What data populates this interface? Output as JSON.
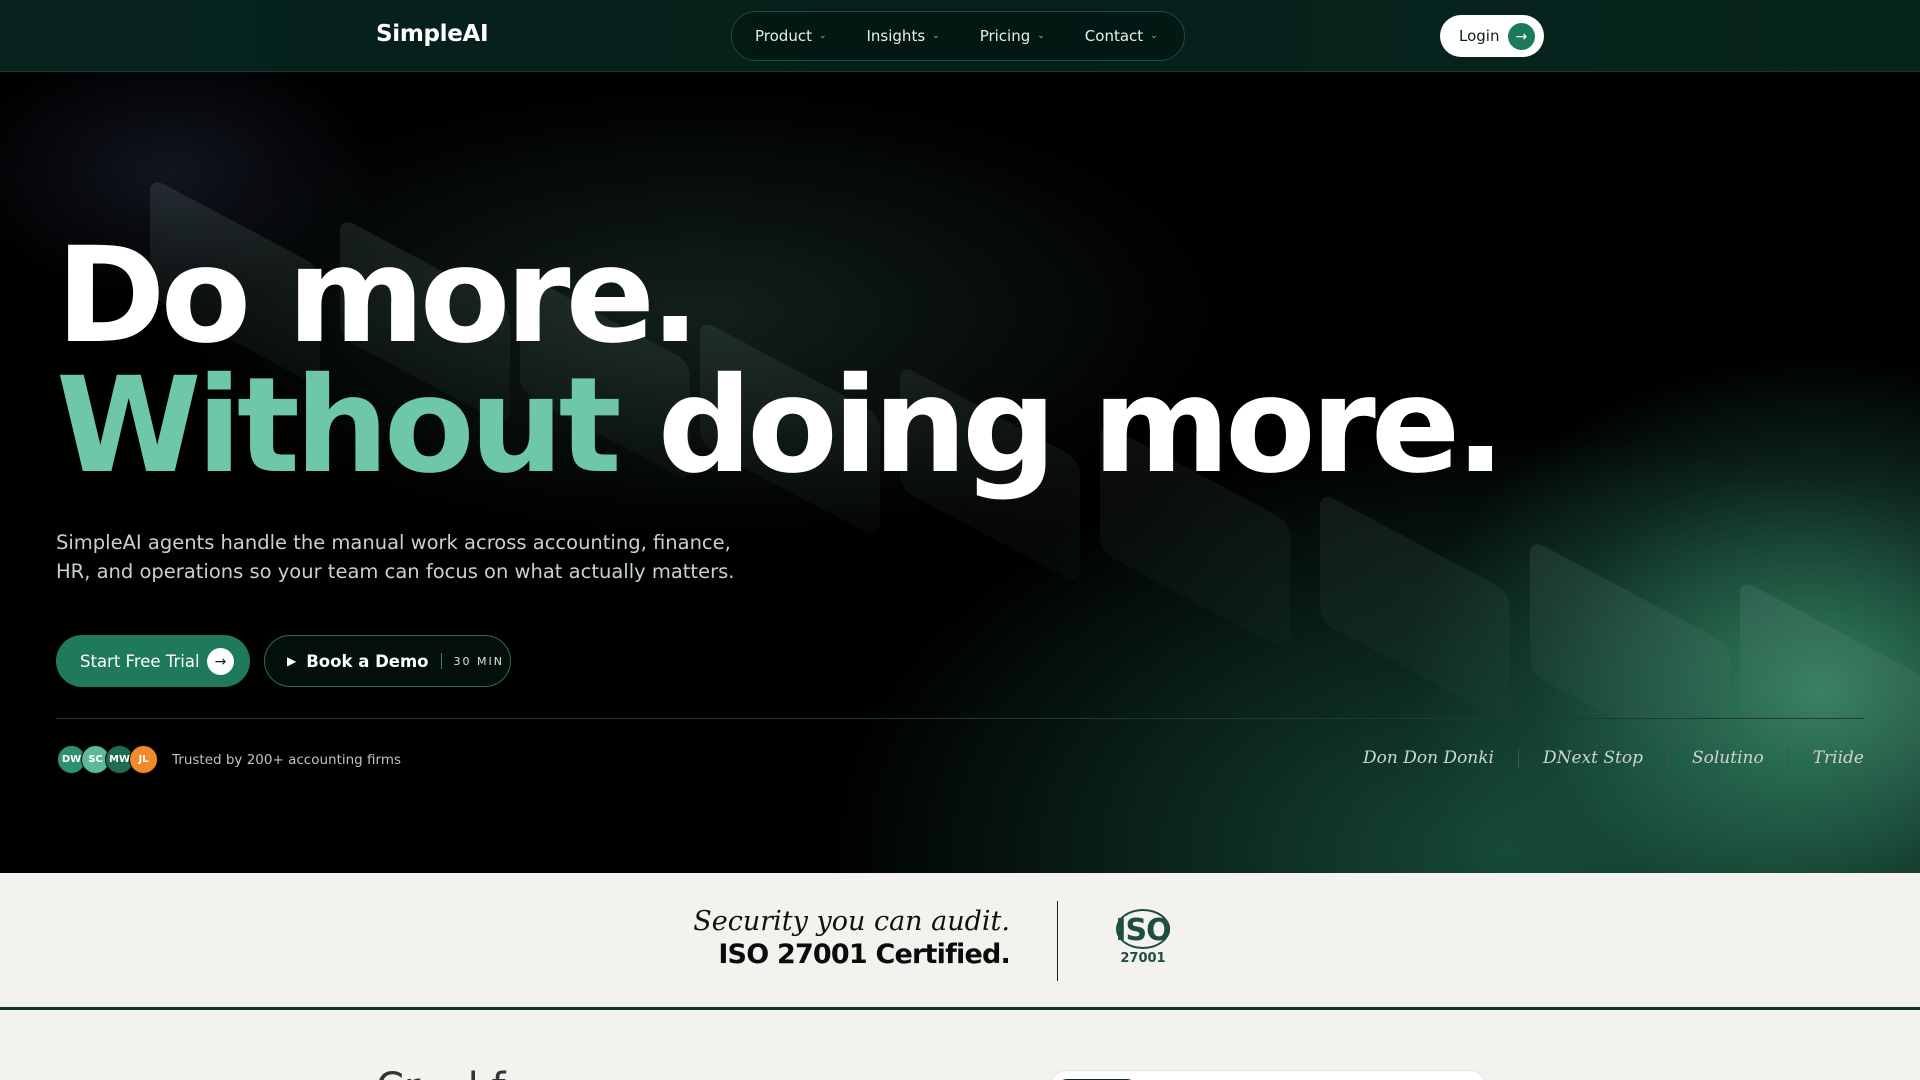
{
  "nav": {
    "brand": "SimpleAI",
    "menu": [
      {
        "label": "Product"
      },
      {
        "label": "Insights"
      },
      {
        "label": "Pricing"
      },
      {
        "label": "Contact"
      }
    ],
    "login_label": "Login"
  },
  "hero": {
    "line1": "Do more.",
    "line2_accent": "Without",
    "line2_rest": "doing more.",
    "subtitle": "SimpleAI agents handle the manual work across accounting, finance, HR, and operations so your team can focus on what actually matters.",
    "cta_primary": "Start Free Trial",
    "cta_secondary": "Book a Demo",
    "cta_secondary_duration": "30 MIN",
    "avatars": [
      {
        "initials": "DW",
        "color": "#2f8f6f"
      },
      {
        "initials": "SC",
        "color": "#5fb89a"
      },
      {
        "initials": "MW",
        "color": "#1f6b53"
      },
      {
        "initials": "JL",
        "color": "#f08a2a"
      }
    ],
    "trusted": "Trusted by 200+ accounting firms",
    "clients": [
      "Don Don Donki",
      "DNext Stop",
      "Solutino",
      "Triide"
    ]
  },
  "security": {
    "line1": "Security you can audit.",
    "line2": "ISO 27001 Certified.",
    "badge_text": "ISO",
    "badge_number": "27001"
  },
  "next_section": {
    "title_fragment": "Cr... l f..."
  },
  "colors": {
    "accent": "#6ec7a6",
    "primary_button": "#1e7a5b",
    "nav_bg": "#05201a",
    "band_bg": "#f3f2ee"
  }
}
